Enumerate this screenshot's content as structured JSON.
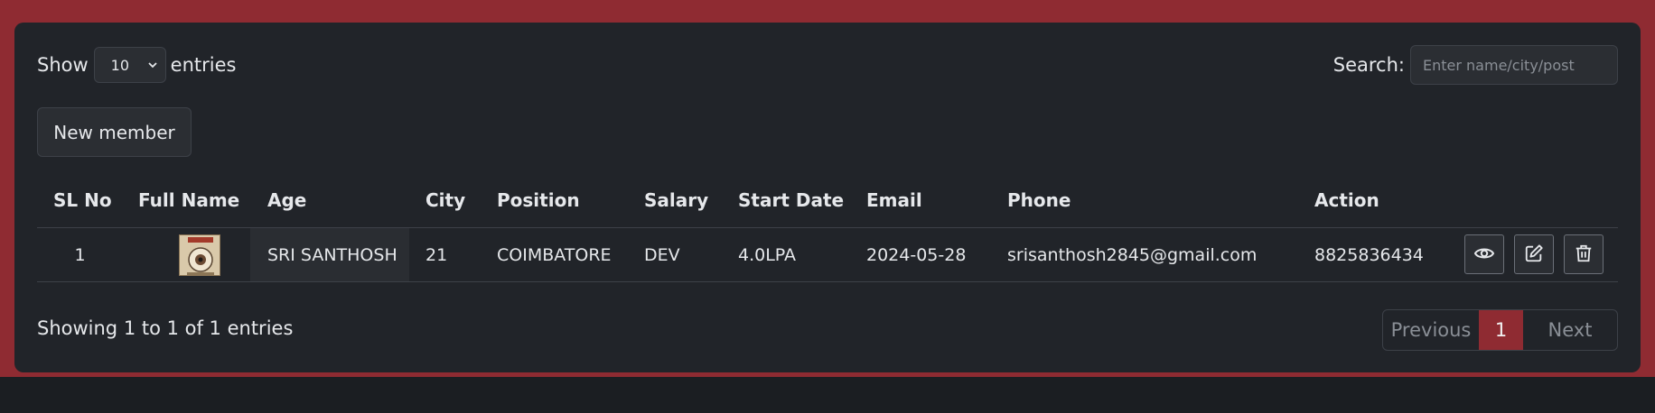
{
  "controls": {
    "show_label": "Show",
    "entries_value": "10",
    "entries_label": "entries",
    "search_label": "Search:",
    "search_placeholder": "Enter name/city/post",
    "new_member": "New member"
  },
  "table": {
    "headers": {
      "sl_no": "SL No",
      "full_name": "Full Name",
      "age": "Age",
      "city": "City",
      "position": "Position",
      "salary": "Salary",
      "start_date": "Start Date",
      "email": "Email",
      "phone": "Phone",
      "action": "Action"
    },
    "rows": [
      {
        "sl_no": "1",
        "name_col": "SRI SANTHOSH",
        "age_col": "21",
        "city_col": "COIMBATORE",
        "position_col": "DEV",
        "salary_col": "4.0LPA",
        "start_date_col": "2024-05-28",
        "email_col": "srisanthosh2845@gmail.com",
        "phone_col": "8825836434"
      }
    ]
  },
  "footer": {
    "info": "Showing 1 to 1 of 1 entries",
    "previous": "Previous",
    "page": "1",
    "next": "Next"
  },
  "colors": {
    "accent": "#8f2b32",
    "card_bg": "#212429",
    "page_bg": "#1b1e22"
  },
  "icons": {
    "view": "eye-icon",
    "edit": "edit-icon",
    "delete": "trash-icon",
    "dropdown": "chevron-down-icon"
  }
}
